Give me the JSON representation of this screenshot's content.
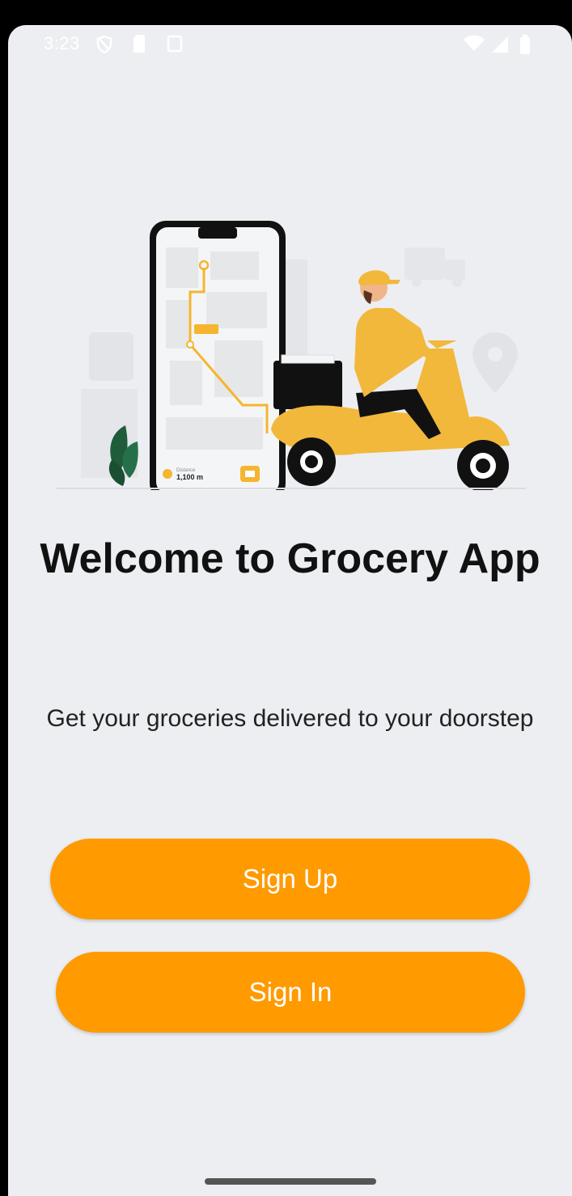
{
  "status_bar": {
    "time": "3:23",
    "icons": [
      "shield-icon",
      "sim-card-icon",
      "screen-icon",
      "wifi-icon",
      "signal-icon",
      "battery-icon"
    ]
  },
  "illustration": {
    "map_distance": "1,100 m",
    "map_distance_label": "Distance"
  },
  "welcome": {
    "title": "Welcome to Grocery App",
    "subtitle": "Get your groceries delivered to your doorstep"
  },
  "buttons": {
    "sign_up": "Sign Up",
    "sign_in": "Sign In"
  },
  "colors": {
    "background": "#eceef1",
    "accent": "#ff9a00",
    "text": "#111111",
    "button_text": "#ffffff"
  }
}
